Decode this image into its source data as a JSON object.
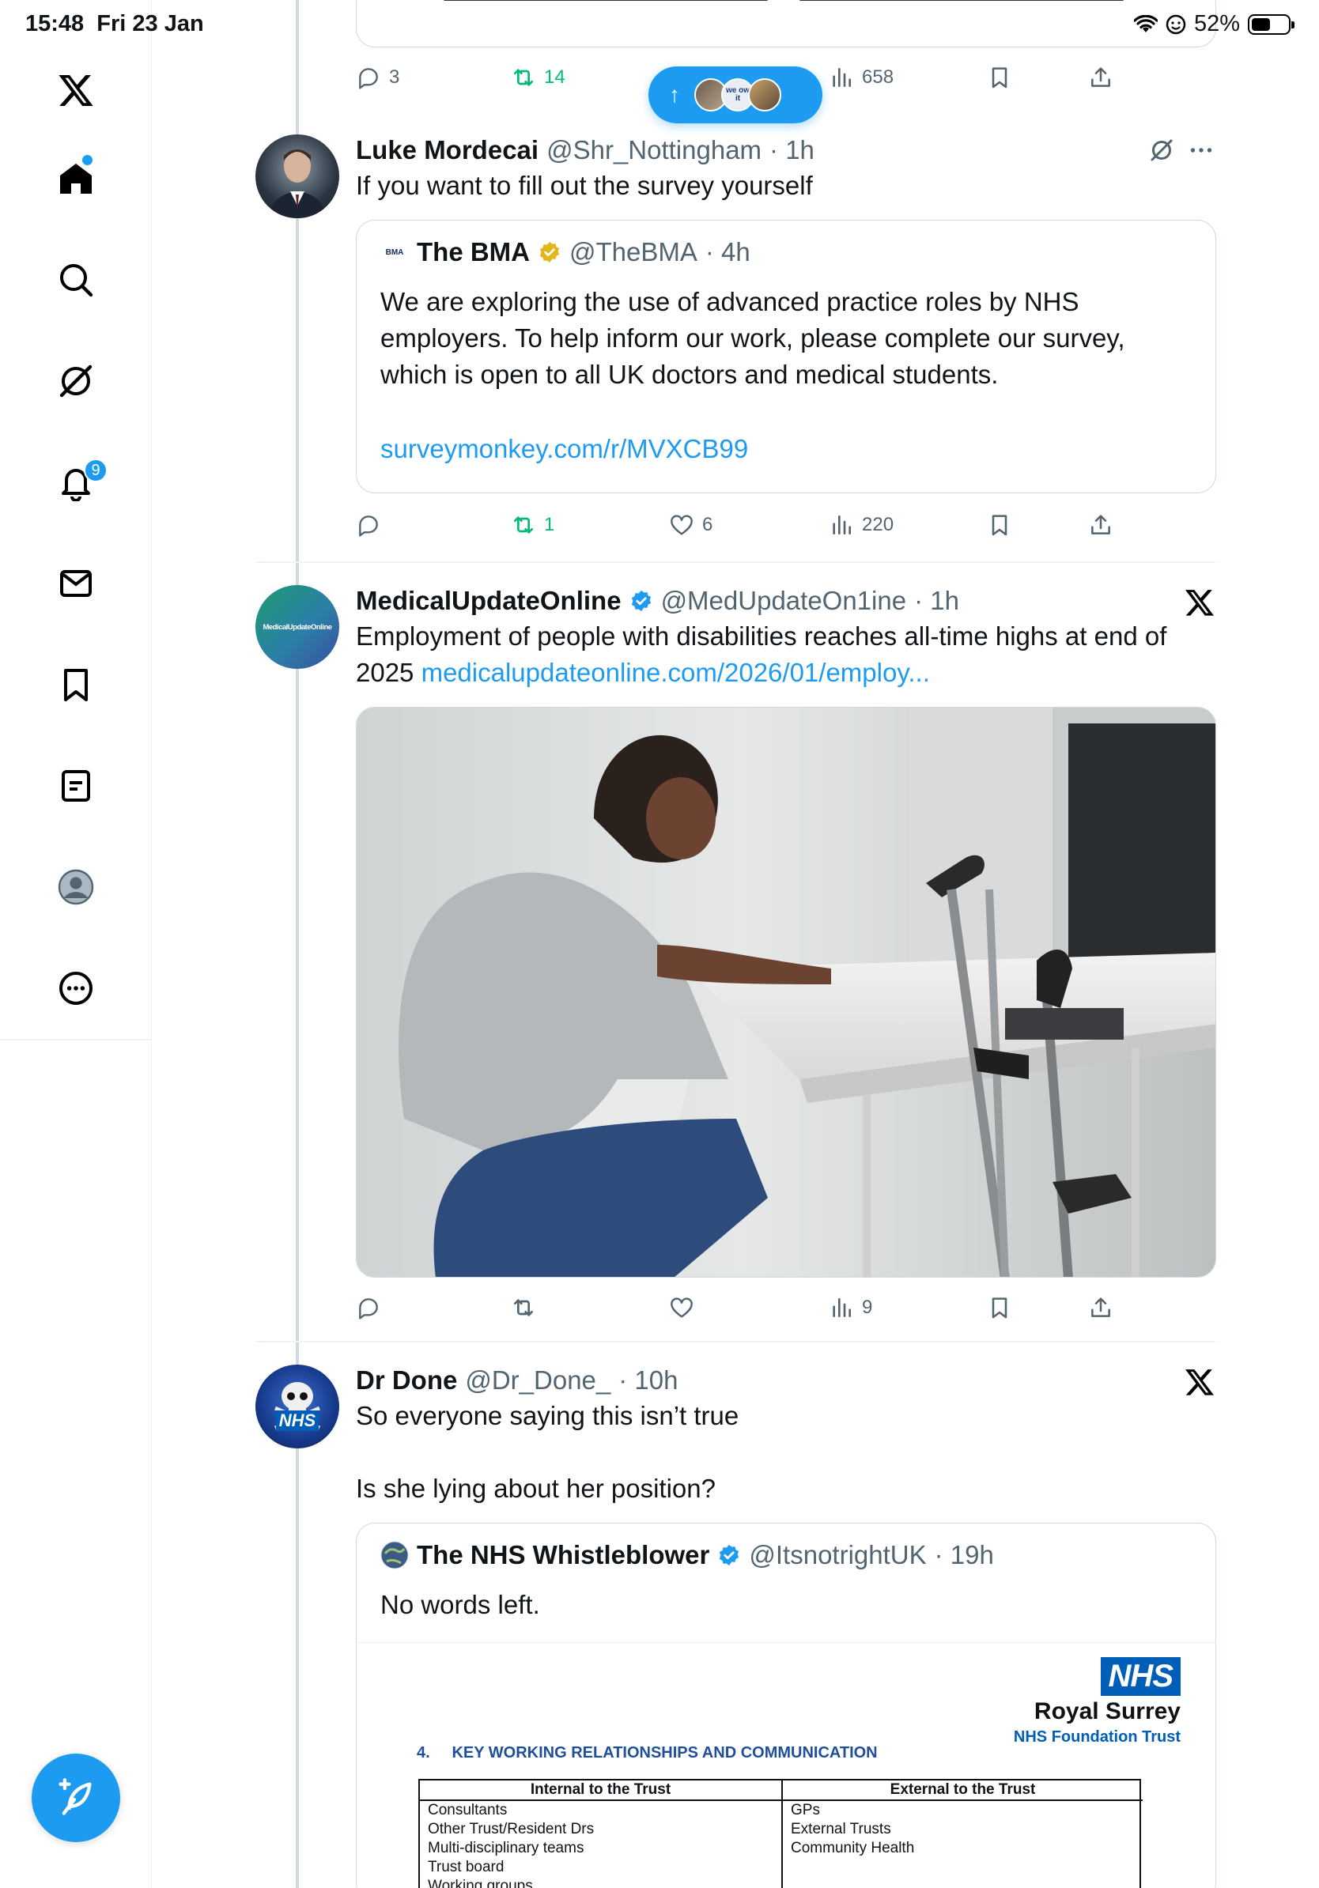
{
  "status_bar": {
    "time": "15:48",
    "date": "Fri 23 Jan",
    "battery": "52%",
    "battery_level": 0.52
  },
  "nav": {
    "notifications_badge": "9"
  },
  "previous_tweet_actions": {
    "replies": "3",
    "reposts": "14",
    "views": "658"
  },
  "new_posts_chip": {
    "arrow": "↑",
    "avatar_text": "we ow it"
  },
  "tweets": [
    {
      "name": "Luke Mordecai",
      "handle": "@Shr_Nottingham",
      "time": "· 1h",
      "text": "If you want to fill out the survey yourself",
      "quote": {
        "name": "The BMA",
        "avatar_text": "BMA",
        "handle": "@TheBMA",
        "time": "· 4h",
        "text": "We are exploring the use of advanced practice roles by NHS employers. To help inform our work, please complete our survey, which is open to all UK doctors and medical students.",
        "link": "surveymonkey.com/r/MVXCB99"
      },
      "actions": {
        "replies": "",
        "reposts": "1",
        "likes": "6",
        "views": "220"
      }
    },
    {
      "name": "MedicalUpdateOnline",
      "avatar_text": "MedicalUpdateOnline",
      "handle": "@MedUpdateOn1ine",
      "time": "· 1h",
      "text_main": "Employment of people with disabilities reaches all-time highs at end of 2025",
      "link": "medicalupdateonline.com/2026/01/employ...",
      "actions": {
        "replies": "",
        "reposts": "",
        "likes": "",
        "views": "9"
      }
    },
    {
      "name": "Dr Done",
      "avatar_text": "NHS",
      "handle": "@Dr_Done_",
      "time": "· 10h",
      "text_line1": "So everyone saying this isn’t true",
      "text_line2": "Is she lying about her position?",
      "quote": {
        "name": "The NHS Whistleblower",
        "handle": "@ItsnotrightUK",
        "time": "· 19h",
        "text": "No words left.",
        "document": {
          "logo": "NHS",
          "org": "Royal Surrey",
          "trust": "NHS Foundation Trust",
          "heading_num": "4.",
          "heading": "KEY WORKING RELATIONSHIPS AND COMMUNICATION",
          "col1_head": "Internal to the Trust",
          "col2_head": "External to the Trust",
          "col1_items": [
            "Consultants",
            "Other Trust/Resident Drs",
            "Multi-disciplinary teams",
            "Trust board",
            "Working groups"
          ],
          "col2_items": [
            "GPs",
            "External Trusts",
            "Community Health"
          ]
        }
      }
    }
  ],
  "colors": {
    "accent": "#1d9bf0",
    "repost_green": "#00ba7c",
    "secondary_text": "#536471",
    "nhs_blue": "#005eb8"
  }
}
